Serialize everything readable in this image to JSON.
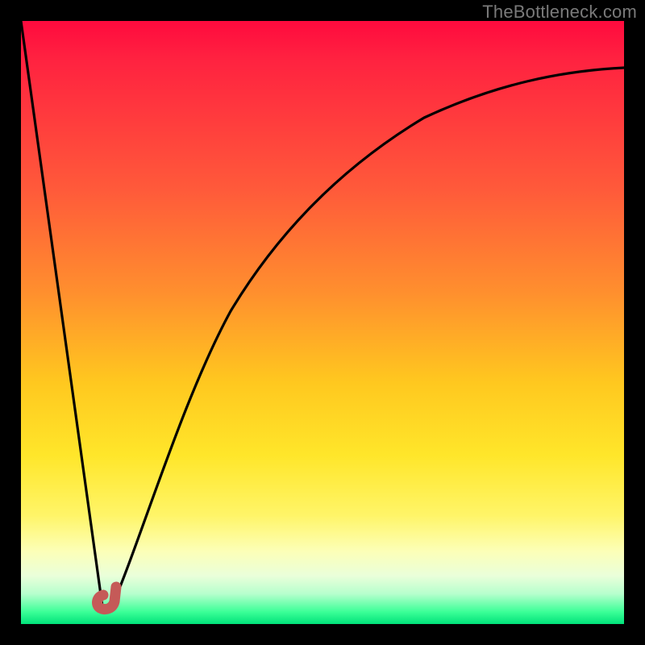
{
  "watermark": {
    "text": "TheBottleneck.com"
  },
  "chart_data": {
    "type": "line",
    "title": "",
    "xlabel": "",
    "ylabel": "",
    "xlim": [
      0,
      100
    ],
    "ylim": [
      0,
      100
    ],
    "grid": false,
    "legend": false,
    "series": [
      {
        "name": "bottleneck-curve",
        "x": [
          0,
          2,
          4,
          6,
          8,
          10,
          12,
          13.5,
          15,
          17,
          19,
          21,
          24,
          27,
          30,
          34,
          38,
          43,
          48,
          54,
          60,
          67,
          74,
          82,
          90,
          100
        ],
        "y": [
          100,
          86,
          72,
          58,
          44,
          30,
          16,
          3,
          3,
          11,
          23,
          34,
          46,
          55,
          62,
          68,
          73,
          77,
          80.5,
          83.5,
          85.8,
          87.7,
          89.2,
          90.4,
          91.3,
          92.1
        ]
      }
    ],
    "marker": {
      "name": "optimal-point",
      "x": 14,
      "y": 3,
      "shape": "j-hook",
      "color": "#c55a58"
    },
    "gradient_stops": [
      {
        "pos": 0.0,
        "color": "#ff0a3e"
      },
      {
        "pos": 0.28,
        "color": "#ff5a3a"
      },
      {
        "pos": 0.6,
        "color": "#ffc81f"
      },
      {
        "pos": 0.82,
        "color": "#fff568"
      },
      {
        "pos": 0.95,
        "color": "#b6ffcd"
      },
      {
        "pos": 1.0,
        "color": "#00e27a"
      }
    ]
  }
}
